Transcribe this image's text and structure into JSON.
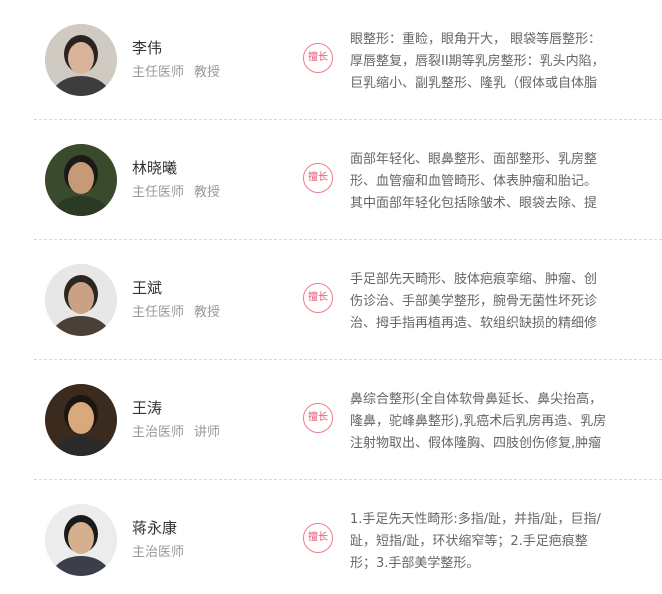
{
  "doctors": [
    {
      "name": "李伟",
      "title": "主任医师",
      "rank": "教授",
      "badge": "擅长",
      "specialty_lines": [
        "眼整形：重睑，眼角开大， 眼袋等唇整形：",
        "厚唇整复，唇裂II期等乳房整形：乳头内陷，",
        "巨乳缩小、副乳整形、隆乳（假体或自体脂"
      ],
      "avatar_colors": {
        "bg": "#cfcac2",
        "hair": "#2a2320",
        "face": "#d9b49a",
        "body": "#3d3d3d"
      }
    },
    {
      "name": "林晓曦",
      "title": "主任医师",
      "rank": "教授",
      "badge": "擅长",
      "specialty_lines": [
        "面部年轻化、眼鼻整形、面部整形、乳房整",
        "形、血管瘤和血管畸形、体表肿瘤和胎记。",
        "其中面部年轻化包括除皱术、眼袋去除、提"
      ],
      "avatar_colors": {
        "bg": "#3a4a2c",
        "hair": "#1c1a18",
        "face": "#c69a76",
        "body": "#2b3a22"
      }
    },
    {
      "name": "王斌",
      "title": "主任医师",
      "rank": "教授",
      "badge": "擅长",
      "specialty_lines": [
        "手足部先天畸形、肢体疤痕挛缩、肿瘤、创",
        "伤诊治、手部美学整形，腕骨无菌性坏死诊",
        "治、拇手指再植再造、软组织缺损的精细修"
      ],
      "avatar_colors": {
        "bg": "#e7e7e7",
        "hair": "#2a2622",
        "face": "#caa184",
        "body": "#4a4038"
      }
    },
    {
      "name": "王涛",
      "title": "主治医师",
      "rank": "讲师",
      "badge": "擅长",
      "specialty_lines": [
        "鼻综合整形(全自体软骨鼻延长、鼻尖抬高，",
        "隆鼻，驼峰鼻整形),乳癌术后乳房再造、乳房",
        "注射物取出、假体隆胸、四肢创伤修复,肿瘤"
      ],
      "avatar_colors": {
        "bg": "#3b2a1e",
        "hair": "#1d1610",
        "face": "#d9a97e",
        "body": "#2a2a2a"
      }
    },
    {
      "name": "蒋永康",
      "title": "主治医师",
      "rank": "",
      "badge": "擅长",
      "specialty_lines": [
        "1.手足先天性畸形:多指/趾，并指/趾，巨指/",
        "趾，短指/趾，环状缩窄等；2.手足疤痕整",
        "形；3.手部美学整形。"
      ],
      "avatar_colors": {
        "bg": "#ececec",
        "hair": "#1a1a1a",
        "face": "#d6b08e",
        "body": "#3a3f4a"
      }
    }
  ]
}
